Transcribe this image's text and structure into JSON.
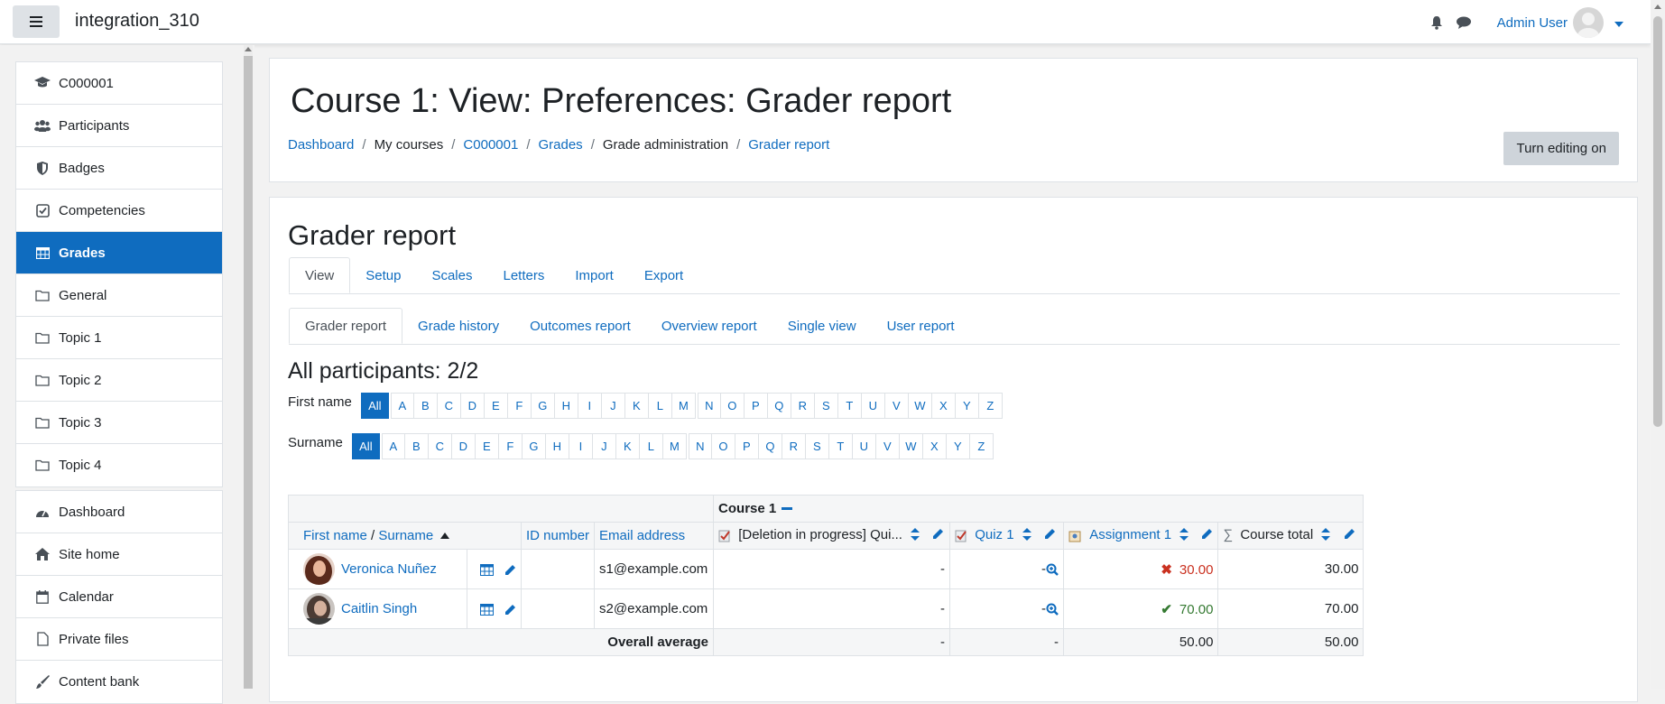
{
  "navbar": {
    "site_name": "integration_310",
    "user_name": "Admin User",
    "menu_icon": "hamburger-icon",
    "notification_icon": "bell-icon",
    "messages_icon": "chat-icon"
  },
  "sidebar": {
    "course_items": [
      {
        "label": "C000001",
        "icon": "graduation-cap-icon"
      },
      {
        "label": "Participants",
        "icon": "users-icon"
      },
      {
        "label": "Badges",
        "icon": "shield-icon"
      },
      {
        "label": "Competencies",
        "icon": "check-square-icon"
      },
      {
        "label": "Grades",
        "icon": "table-icon",
        "active": true
      },
      {
        "label": "General",
        "icon": "folder-icon"
      },
      {
        "label": "Topic 1",
        "icon": "folder-icon"
      },
      {
        "label": "Topic 2",
        "icon": "folder-icon"
      },
      {
        "label": "Topic 3",
        "icon": "folder-icon"
      },
      {
        "label": "Topic 4",
        "icon": "folder-icon"
      }
    ],
    "site_items": [
      {
        "label": "Dashboard",
        "icon": "dashboard-icon"
      },
      {
        "label": "Site home",
        "icon": "home-icon"
      },
      {
        "label": "Calendar",
        "icon": "calendar-icon"
      },
      {
        "label": "Private files",
        "icon": "file-icon"
      },
      {
        "label": "Content bank",
        "icon": "paint-brush-icon"
      }
    ]
  },
  "header": {
    "title": "Course 1: View: Preferences: Grader report",
    "breadcrumb": [
      {
        "label": "Dashboard",
        "link": true
      },
      {
        "label": "My courses",
        "link": false
      },
      {
        "label": "C000001",
        "link": true
      },
      {
        "label": "Grades",
        "link": true
      },
      {
        "label": "Grade administration",
        "link": false
      },
      {
        "label": "Grader report",
        "link": true
      }
    ],
    "edit_button": "Turn editing on"
  },
  "main": {
    "heading": "Grader report",
    "tabs": [
      "View",
      "Setup",
      "Scales",
      "Letters",
      "Import",
      "Export"
    ],
    "subtabs": [
      "Grader report",
      "Grade history",
      "Outcomes report",
      "Overview report",
      "Single view",
      "User report"
    ],
    "participants_heading": "All participants: 2/2",
    "first_name_label": "First name",
    "surname_label": "Surname",
    "all_label": "All",
    "letters": [
      "A",
      "B",
      "C",
      "D",
      "E",
      "F",
      "G",
      "H",
      "I",
      "J",
      "K",
      "L",
      "M",
      "N",
      "O",
      "P",
      "Q",
      "R",
      "S",
      "T",
      "U",
      "V",
      "W",
      "X",
      "Y",
      "Z"
    ]
  },
  "grade_table": {
    "category": "Course 1",
    "headers": {
      "name_first": "First name",
      "name_sep": " / ",
      "name_surname": "Surname",
      "id_number": "ID number",
      "email": "Email address",
      "items": [
        {
          "label": "[Deletion in progress] Qui...",
          "icon": "quiz-icon",
          "link": false
        },
        {
          "label": "Quiz 1",
          "icon": "quiz-icon",
          "link": true
        },
        {
          "label": "Assignment 1",
          "icon": "assignment-icon",
          "link": true
        },
        {
          "label": "Course total",
          "icon": "sigma-icon",
          "link": false
        }
      ]
    },
    "rows": [
      {
        "name": "Veronica Nuñez",
        "email": "s1@example.com",
        "deletion": "-",
        "quiz": "-",
        "assignment": "30.00",
        "assignment_status": "fail",
        "total": "30.00"
      },
      {
        "name": "Caitlin Singh",
        "email": "s2@example.com",
        "deletion": "-",
        "quiz": "-",
        "assignment": "70.00",
        "assignment_status": "pass",
        "total": "70.00"
      }
    ],
    "average": {
      "label": "Overall average",
      "deletion": "-",
      "quiz": "-",
      "assignment": "50.00",
      "total": "50.00"
    }
  },
  "colors": {
    "accent": "#0f6cbf",
    "fail": "#ca3120",
    "pass": "#357a32"
  }
}
